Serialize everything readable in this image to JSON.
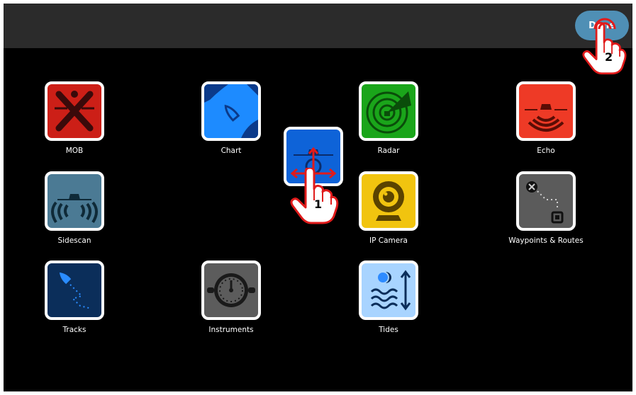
{
  "header": {
    "done_label": "Done"
  },
  "apps": [
    {
      "label": "MOB",
      "icon": "mob-icon",
      "bg": "#cc1f17"
    },
    {
      "label": "Chart",
      "icon": "chart-icon",
      "bg": "#1d8bff"
    },
    {
      "label": "Radar",
      "icon": "radar-icon",
      "bg": "#1aa51a"
    },
    {
      "label": "Echo",
      "icon": "echo-icon",
      "bg": "#ee3a26"
    },
    {
      "label": "Sidescan",
      "icon": "sidescan-icon",
      "bg": "#4b7a94"
    },
    {
      "label": "IP Camera",
      "icon": "ip-camera-icon",
      "bg": "#f1c40f"
    },
    {
      "label": "Waypoints & Routes",
      "icon": "waypoints-icon",
      "bg": "#5b5b5b"
    },
    {
      "label": "Tracks",
      "icon": "tracks-icon",
      "bg": "#0b2e5a"
    },
    {
      "label": "Instruments",
      "icon": "instruments-icon",
      "bg": "#5c5c5c"
    },
    {
      "label": "Tides",
      "icon": "tides-icon",
      "bg": "#a8d4ff"
    }
  ],
  "dragging_app": {
    "icon": "dragging-app-icon",
    "bg": "#0e63d8"
  },
  "gesture_steps": [
    "1",
    "2"
  ]
}
